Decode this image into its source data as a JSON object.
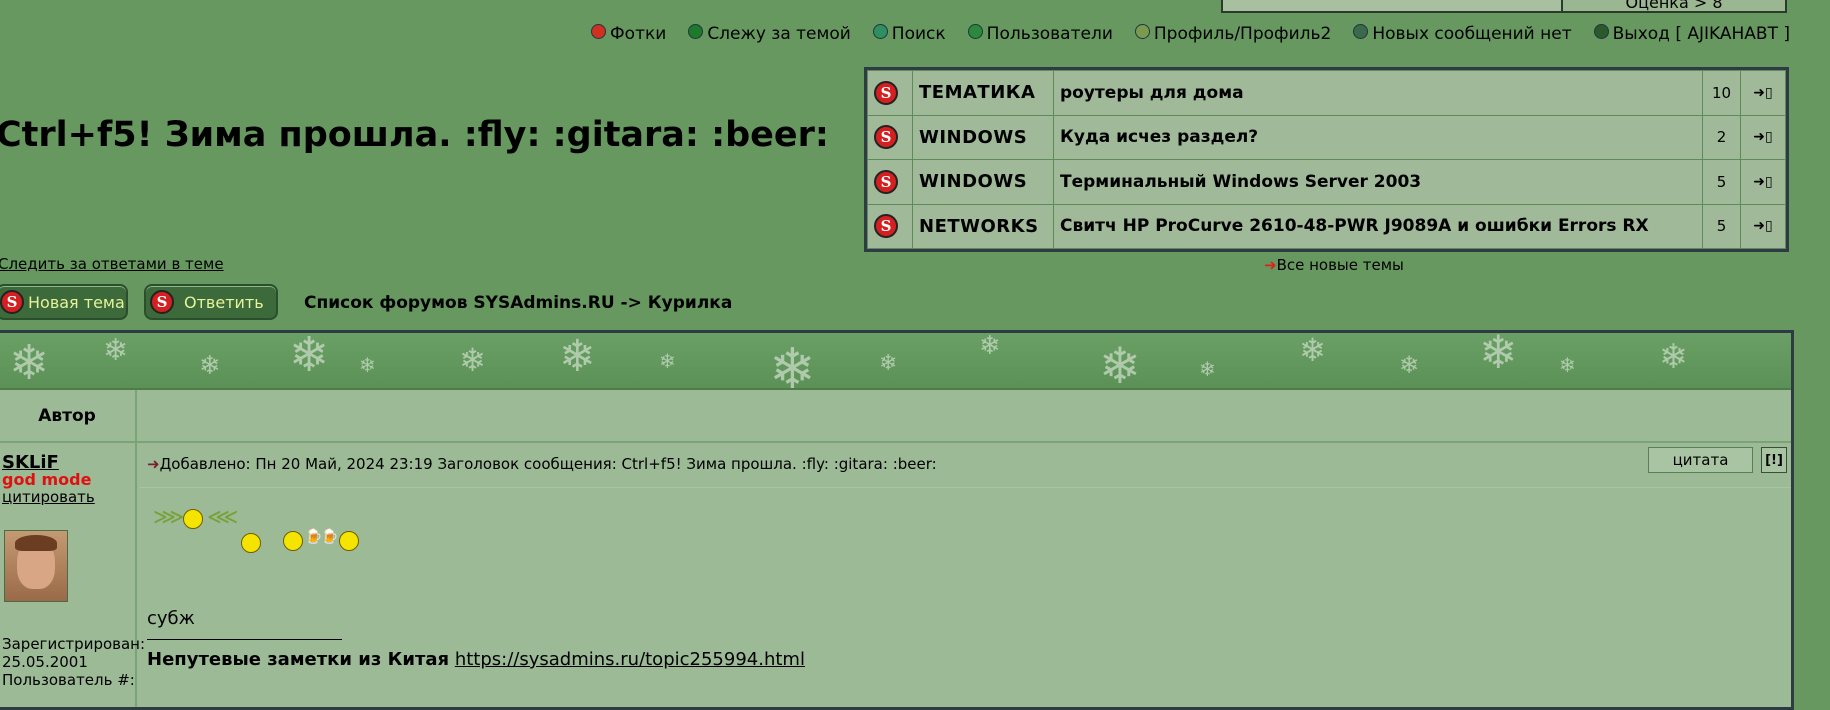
{
  "top": {
    "rating_label": "Оценка > 8"
  },
  "nav": {
    "items": [
      {
        "label": "Фотки",
        "icon": "red-dot-icon",
        "color": "#d03020"
      },
      {
        "label": "Слежу за темой",
        "icon": "green-dot-icon",
        "color": "#1c7a2a"
      },
      {
        "label": "Поиск",
        "icon": "search-dot-icon",
        "color": "#2f8f5f"
      },
      {
        "label": "Пользователи",
        "icon": "users-dot-icon",
        "color": "#2a8a3a"
      },
      {
        "label": "Профиль/Профиль2",
        "icon": "profile-dot-icon",
        "color": "#7a9a50"
      },
      {
        "label": "Новых сообщений нет",
        "icon": "messages-icon",
        "color": "#3a6a4a"
      },
      {
        "label": "Выход [ AJIKAHABT ]",
        "icon": "clock-icon",
        "color": "#2a5a2a"
      }
    ]
  },
  "topic": {
    "title": "Ctrl+f5! Зима прошла. :fly: :gitara: :beer:",
    "watch_label": "Следить за ответами в теме"
  },
  "buttons": {
    "new_topic": "Новая тема",
    "reply": "Ответить"
  },
  "breadcrumb": "Список форумов SYSAdmins.RU -> Курилка",
  "recent_topics": [
    {
      "category": "ТЕМАТИКА",
      "title": "роутеры для дома",
      "count": "10"
    },
    {
      "category": "WINDOWS",
      "title": "Куда исчез раздел?",
      "count": "2"
    },
    {
      "category": "WINDOWS",
      "title": "Терминальный Windows Server 2003",
      "count": "5"
    },
    {
      "category": "NETWORKS",
      "title": "Свитч HP ProCurve 2610-48-PWR J9089A и ошибки Errors RX",
      "count": "5"
    }
  ],
  "all_new_label": "Все новые темы",
  "table": {
    "author_header": "Автор"
  },
  "post": {
    "author": "SKLiF",
    "rank": "god mode",
    "quote_link": "цитировать",
    "reg_label": "Зарегистрирован:",
    "reg_date": "25.05.2001",
    "user_num_label": "Пользователь #:",
    "meta": "Добавлено: Пн 20 Май, 2024 23:19    Заголовок сообщения: Ctrl+f5! Зима прошла. :fly: :gitara: :beer:",
    "quote_button": "цитата",
    "report_button": "[!]",
    "text": "субж",
    "signature_bold": "Непутевые заметки из Китая",
    "signature_link": "https://sysadmins.ru/topic255994.html"
  }
}
